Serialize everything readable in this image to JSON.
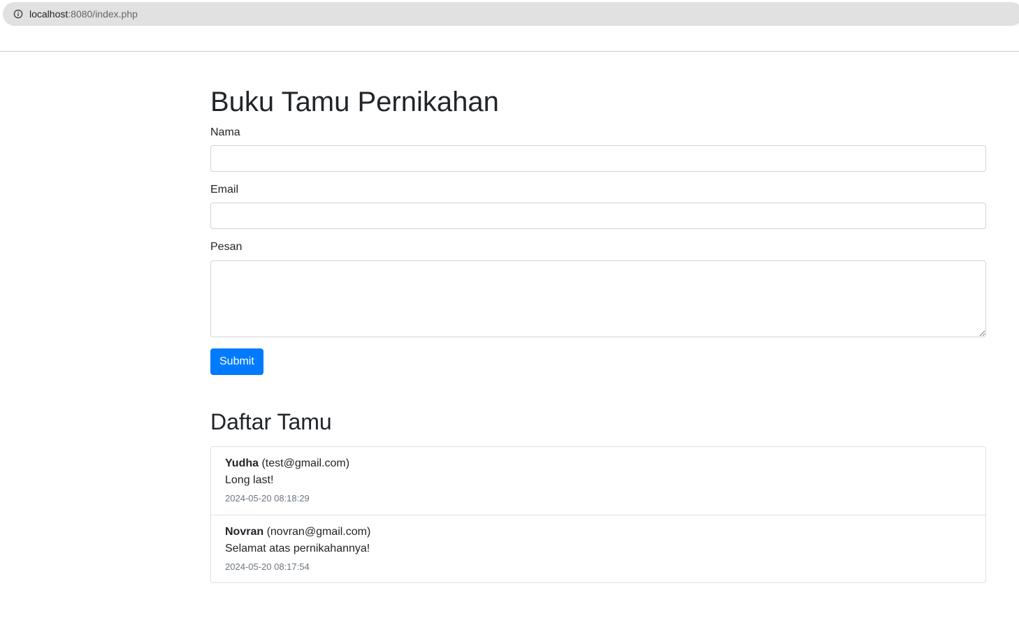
{
  "browser": {
    "url_host": "localhost",
    "url_rest": ":8080/index.php"
  },
  "page": {
    "title": "Buku Tamu Pernikahan",
    "form": {
      "name_label": "Nama",
      "name_value": "",
      "email_label": "Email",
      "email_value": "",
      "message_label": "Pesan",
      "message_value": "",
      "submit_label": "Submit"
    },
    "guest_list_title": "Daftar Tamu",
    "guests": [
      {
        "name": "Yudha",
        "email": "(test@gmail.com)",
        "message": "Long last!",
        "timestamp": "2024-05-20 08:18:29"
      },
      {
        "name": "Novran",
        "email": "(novran@gmail.com)",
        "message": "Selamat atas pernikahannya!",
        "timestamp": "2024-05-20 08:17:54"
      }
    ]
  },
  "colors": {
    "primary": "#007bff",
    "text": "#212529",
    "muted": "#6c757d"
  }
}
